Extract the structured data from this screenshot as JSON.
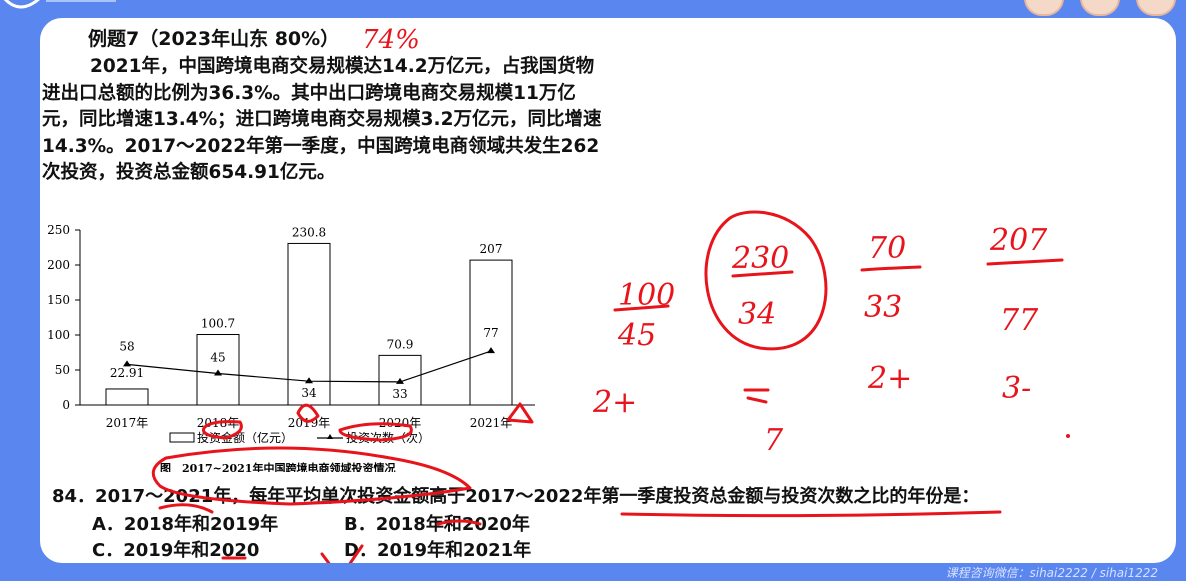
{
  "problem": {
    "title": "例题7（2023年山东 80%）",
    "paragraph": "2021年，中国跨境电商交易规模达14.2万亿元，占我国货物进出口总额的比例为36.3%。其中出口跨境电商交易规模11万亿元，同比增速13.4%；进口跨境电商交易规模3.2万亿元，同比增速14.3%。2017～2022年第一季度，中国跨境电商领域共发生262次投资，投资总金额654.91亿元。",
    "question": "84．2017～2021年，每年平均单次投资金额高于2017～2022年第一季度投资总金额与投资次数之比的年份是：",
    "options": {
      "A": "A．2018年和2019年",
      "B": "B．2018年和2020年",
      "C": "C．2019年和2020",
      "D": "D．2019年和2021年"
    }
  },
  "chart_data": {
    "type": "bar+line",
    "categories": [
      "2017年",
      "2018年",
      "2019年",
      "2020年",
      "2021年"
    ],
    "series": [
      {
        "name": "投资金额（亿元）",
        "type": "bar",
        "values": [
          22.91,
          100.7,
          230.8,
          70.9,
          207
        ]
      },
      {
        "name": "投资次数（次）",
        "type": "line",
        "values": [
          58,
          45,
          34,
          33,
          77
        ]
      }
    ],
    "y_ticks": [
      "0",
      "50",
      "100",
      "150",
      "200",
      "250"
    ],
    "ylim": [
      0,
      250
    ],
    "caption": "图　2017~2021年中国跨境电商领域投资情况",
    "legend_position": "bottom"
  },
  "annotations": {
    "score_mark": "74%",
    "fractions": [
      {
        "num": "100",
        "den": "45",
        "note": "2+"
      },
      {
        "num": "230",
        "den": "34",
        "note": "7"
      },
      {
        "num": "70",
        "den": "33",
        "note": "2+"
      },
      {
        "num": "207",
        "den": "77",
        "note": "3-"
      }
    ]
  },
  "watermark": "课程咨询微信：sihai2222 / sihai1222",
  "colors": {
    "background": "#5a86f0",
    "card": "#ffffff",
    "ink": "#e8141b",
    "text": "#111111"
  }
}
